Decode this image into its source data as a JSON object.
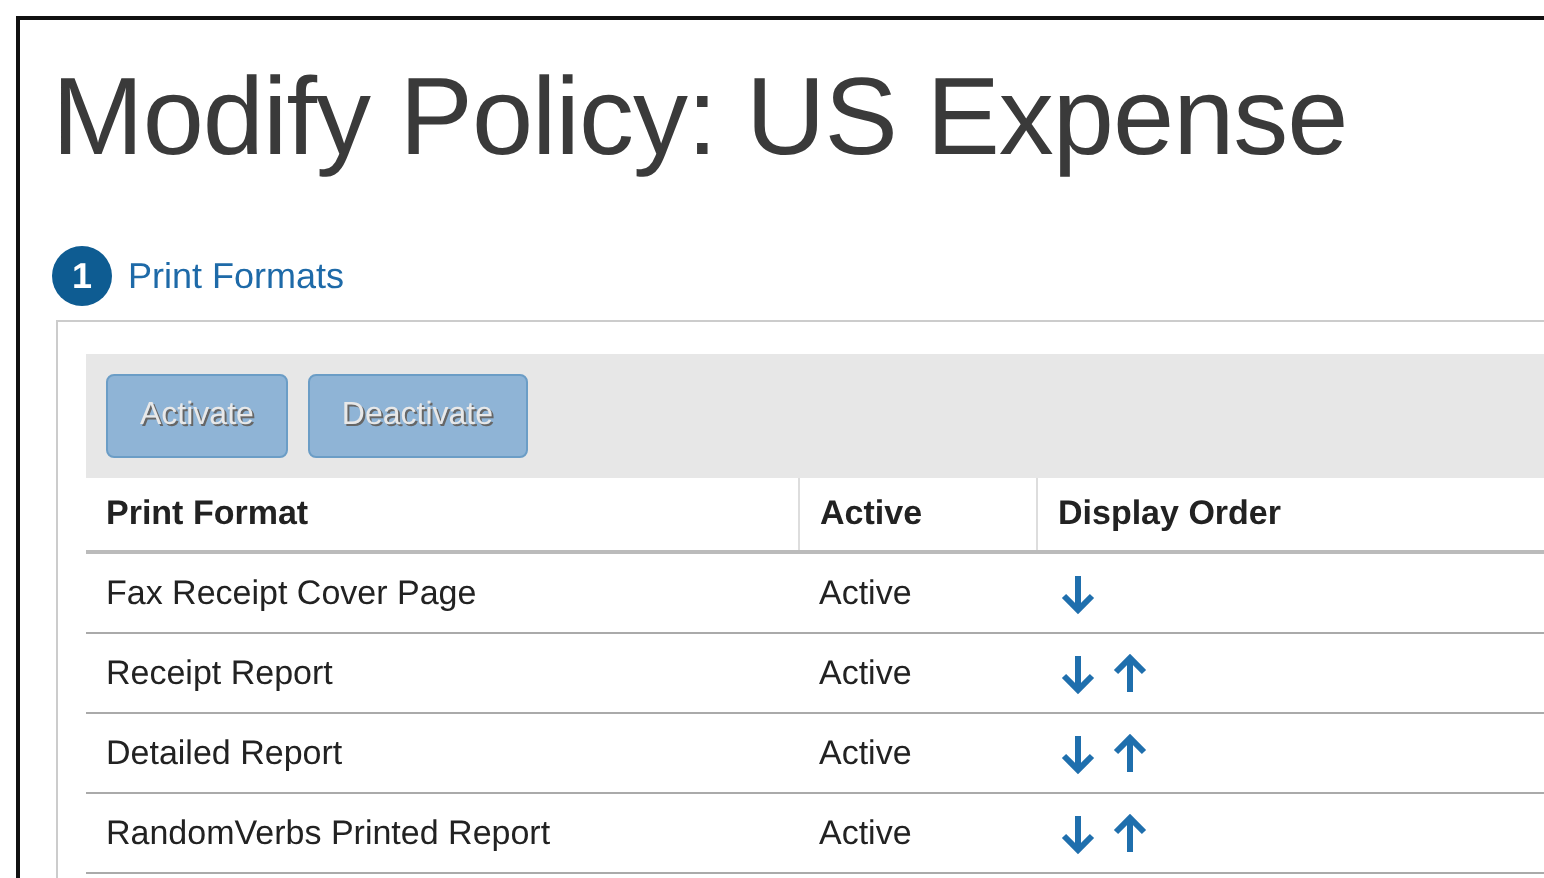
{
  "page": {
    "title": "Modify Policy: US Expense"
  },
  "step": {
    "number": "1",
    "label": "Print Formats"
  },
  "toolbar": {
    "buttons": [
      {
        "label": "Activate",
        "disabled": true
      },
      {
        "label": "Deactivate",
        "disabled": true
      }
    ]
  },
  "table": {
    "columns": [
      "Print Format",
      "Active",
      "Display Order"
    ],
    "rows": [
      {
        "name": "Fax Receipt Cover Page",
        "active": "Active",
        "move_down": true,
        "move_up": false
      },
      {
        "name": "Receipt Report",
        "active": "Active",
        "move_down": true,
        "move_up": true
      },
      {
        "name": "Detailed Report",
        "active": "Active",
        "move_down": true,
        "move_up": true
      },
      {
        "name": "RandomVerbs Printed Report",
        "active": "Active",
        "move_down": true,
        "move_up": true
      }
    ]
  }
}
